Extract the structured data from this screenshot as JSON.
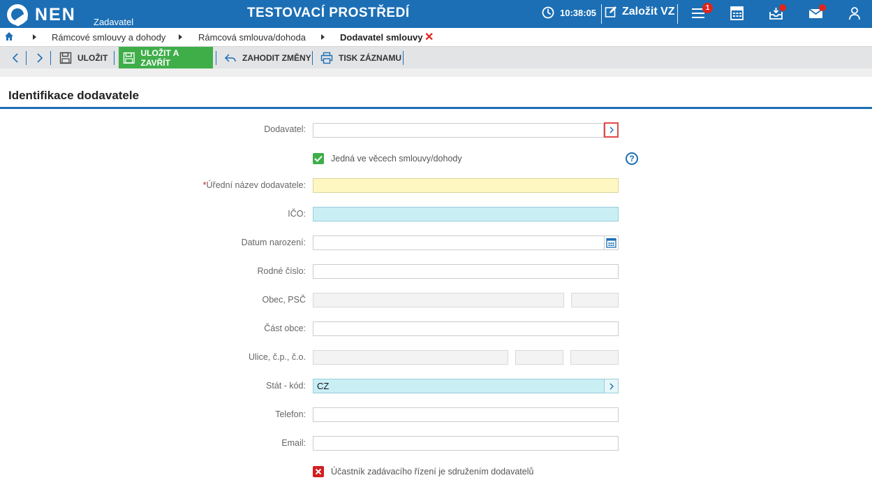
{
  "header": {
    "logo_text": "NEN",
    "logo_subtitle": "Zadavatel",
    "environment_title": "TESTOVACÍ PROSTŘEDÍ",
    "time": "10:38:05",
    "create_label": "Založit VZ",
    "menu_badge_count": "1",
    "brand_color": "#1c6fb5"
  },
  "breadcrumb": {
    "items": [
      "Rámcové smlouvy a dohody",
      "Rámcová smlouva/dohoda",
      "Dodavatel smlouvy"
    ]
  },
  "toolbar": {
    "save_label": "ULOŽIT",
    "save_close_label": "ULOŽIT A ZAVŘÍT",
    "discard_label": "ZAHODIT ZMĚNY",
    "print_label": "TISK ZÁZNAMU"
  },
  "section": {
    "title": "Identifikace dodavatele"
  },
  "form": {
    "supplier_label": "Dodavatel:",
    "supplier_value": "",
    "acting_checkbox_label": "Jedná ve věcech smlouvy/dohody",
    "acting_checked": true,
    "official_name_label": "Úřední název dodavatele:",
    "official_name_value": "",
    "ico_label": "IČO:",
    "ico_value": "",
    "birth_date_label": "Datum narození:",
    "birth_date_value": "",
    "birth_number_label": "Rodné číslo:",
    "birth_number_value": "",
    "city_zip_label": "Obec, PSČ",
    "city_part_label": "Část obce:",
    "street_label": "Ulice, č.p., č.o.",
    "country_label": "Stát - kód:",
    "country_value": "CZ",
    "phone_label": "Telefon:",
    "phone_value": "",
    "email_label": "Email:",
    "email_value": "",
    "association_checkbox_label": "Účastník zadávacího řízení je sdružením dodavatelů",
    "association_checked": false
  }
}
